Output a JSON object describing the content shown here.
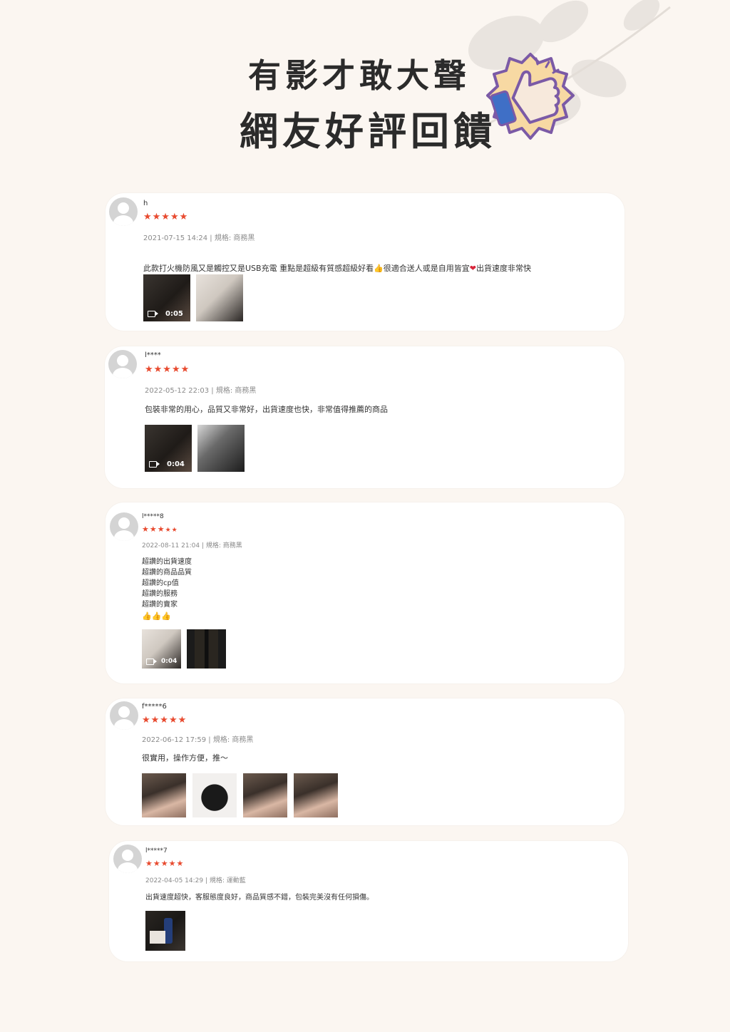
{
  "header": {
    "title_line1": "有影才敢大聲",
    "title_line2": "網友好評回饋"
  },
  "reviews": [
    {
      "user": "h",
      "rating": 5,
      "stars": "★★★★★",
      "meta": "2021-07-15 14:24 | 規格: 商務黑",
      "text_parts": [
        "此款打火機防風又是觸控又是USB充電 重點是超級有質感超級好看",
        "👍",
        "很適合送人或是自用皆宜",
        "❤",
        "出貨速度非常快"
      ],
      "media": [
        {
          "type": "video",
          "duration": "0:05"
        },
        {
          "type": "image"
        }
      ]
    },
    {
      "user": "l****",
      "rating": 5,
      "stars": "★★★★★",
      "meta": "2022-05-12 22:03 | 規格: 商務黑",
      "text": "包裝非常的用心，品質又非常好，出貨速度也快，非常值得推薦的商品",
      "media": [
        {
          "type": "video",
          "duration": "0:04"
        },
        {
          "type": "image"
        }
      ]
    },
    {
      "user": "l*****8",
      "rating": 3,
      "stars": "★★★",
      "stars_dim": "★★",
      "meta": "2022-08-11 21:04 | 規格: 商務黑",
      "text": "超讚的出貨速度\n超讚的商品品質\n超讚的cp值\n超讚的服務\n超讚的賣家",
      "emoji": "👍👍👍",
      "media": [
        {
          "type": "video",
          "duration": "0:04"
        },
        {
          "type": "image"
        }
      ]
    },
    {
      "user": "f*****6",
      "rating": 5,
      "stars": "★★★★★",
      "meta": "2022-06-12 17:59 | 規格: 商務黑",
      "text": "很實用，操作方便，推～",
      "media": [
        {
          "type": "image"
        },
        {
          "type": "image"
        },
        {
          "type": "image"
        },
        {
          "type": "image"
        }
      ]
    },
    {
      "user": "l*****7",
      "rating": 5,
      "stars": "★★★★★",
      "meta": "2022-04-05 14:29 | 規格: 運動藍",
      "text": "出貨速度超快，客服態度良好，商品質感不錯，包裝完美沒有任何損傷。",
      "media": [
        {
          "type": "image"
        }
      ]
    }
  ],
  "colors": {
    "background": "#fbf6f1",
    "star": "#e84a2f",
    "badge_fill": "#f7d9a3",
    "badge_outline": "#7b5aa6",
    "thumb_blue": "#3f6fc6"
  },
  "icons": [
    "thumbs-up-badge-icon",
    "avatar-icon",
    "video-camera-icon"
  ]
}
